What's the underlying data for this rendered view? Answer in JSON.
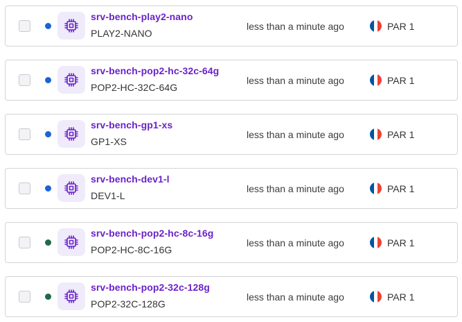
{
  "servers": [
    {
      "name": "srv-bench-play2-nano",
      "type": "PLAY2-NANO",
      "created": "less than a minute ago",
      "zone": "PAR 1",
      "status_color": "#1a64d6",
      "icon": "cpu-chip-icon",
      "flag_icon": "france-flag-icon"
    },
    {
      "name": "srv-bench-pop2-hc-32c-64g",
      "type": "POP2-HC-32C-64G",
      "created": "less than a minute ago",
      "zone": "PAR 1",
      "status_color": "#1a64d6",
      "icon": "cpu-chip-icon",
      "flag_icon": "france-flag-icon"
    },
    {
      "name": "srv-bench-gp1-xs",
      "type": "GP1-XS",
      "created": "less than a minute ago",
      "zone": "PAR 1",
      "status_color": "#1a64d6",
      "icon": "cpu-chip-icon",
      "flag_icon": "france-flag-icon"
    },
    {
      "name": "srv-bench-dev1-l",
      "type": "DEV1-L",
      "created": "less than a minute ago",
      "zone": "PAR 1",
      "status_color": "#1a64d6",
      "icon": "cpu-chip-icon",
      "flag_icon": "france-flag-icon"
    },
    {
      "name": "srv-bench-pop2-hc-8c-16g",
      "type": "POP2-HC-8C-16G",
      "created": "less than a minute ago",
      "zone": "PAR 1",
      "status_color": "#1e6b47",
      "icon": "cpu-chip-icon",
      "flag_icon": "france-flag-icon"
    },
    {
      "name": "srv-bench-pop2-32c-128g",
      "type": "POP2-32C-128G",
      "created": "less than a minute ago",
      "zone": "PAR 1",
      "status_color": "#1e6b47",
      "icon": "cpu-chip-icon",
      "flag_icon": "france-flag-icon"
    }
  ],
  "colors": {
    "accent": "#6a22c9",
    "icon_bg": "#efebfa",
    "flag_blue": "#0055a4",
    "flag_white": "#ffffff",
    "flag_red": "#ef4135"
  }
}
